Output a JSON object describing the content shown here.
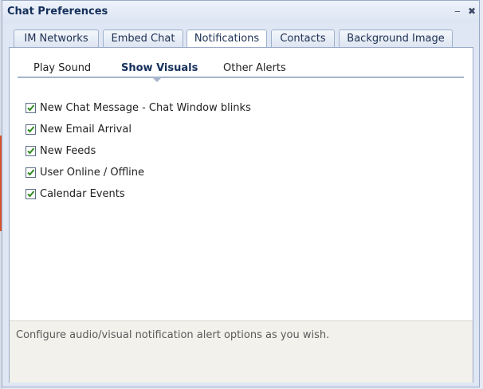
{
  "window": {
    "title": "Chat Preferences",
    "minimize_icon": "minimize-icon",
    "close_icon": "close-icon"
  },
  "tabs": [
    {
      "label": "IM Networks",
      "active": false
    },
    {
      "label": "Embed Chat",
      "active": false
    },
    {
      "label": "Notifications",
      "active": true
    },
    {
      "label": "Contacts",
      "active": false
    },
    {
      "label": "Background Image",
      "active": false
    }
  ],
  "subtabs": [
    {
      "label": "Play Sound",
      "active": false
    },
    {
      "label": "Show Visuals",
      "active": true
    },
    {
      "label": "Other Alerts",
      "active": false
    }
  ],
  "options": [
    {
      "label": "New Chat Message - Chat Window blinks",
      "checked": true
    },
    {
      "label": "New Email Arrival",
      "checked": true
    },
    {
      "label": "New Feeds",
      "checked": true
    },
    {
      "label": "User Online / Offline",
      "checked": true
    },
    {
      "label": "Calendar Events",
      "checked": true
    }
  ],
  "footer": {
    "text": "Configure audio/visual notification alert options as you wish."
  },
  "colors": {
    "title": "#15305b",
    "check": "#2e8b1e",
    "accent_strip": "#d9532c"
  }
}
